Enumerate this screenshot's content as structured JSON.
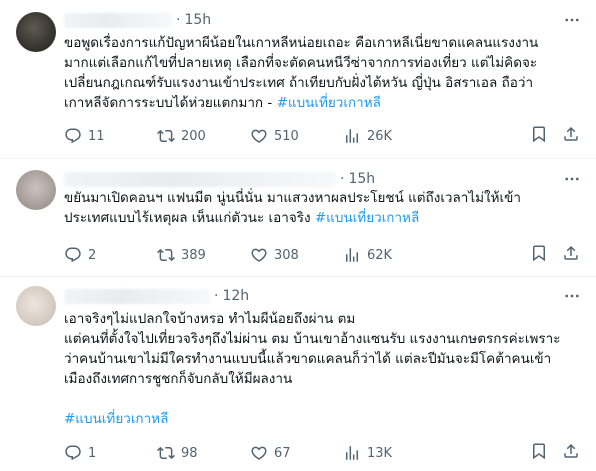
{
  "tweets": [
    {
      "time": "15h",
      "lines": [
        "ขอพูดเรื่องการแก้ปัญหาผีน้อยในเกาหลีหน่อยเถอะ คือเกาหลีเนี่ยขาดแคลนแรงงาน",
        "มากแต่เลือกแก้ไขที่ปลายเหตุ เลือกที่จะตัดคนหนีวีซ่าจากการท่องเที่ยว แต่ไม่คิดจะ",
        "เปลี่ยนกฎเกณฑ์รับแรงงานเข้าประเทศ ถ้าเทียบกับฝั่งไต้หวัน ญี่ปุ่น อิสราเอล ถือว่า"
      ],
      "last_line_text": "เกาหลีจัดการระบบได้ห่วยแตกมาก - ",
      "hashtag": "#แบนเที่ยวเกาหลี",
      "replies": "11",
      "reposts": "200",
      "likes": "510",
      "views": "26K"
    },
    {
      "time": "15h",
      "lines": [
        "ขยันมาเปิดคอนฯ แฟนมีต นู่นนี่นั่น มาแสวงหาผลประโยชน์ แต่ถึงเวลาไม่ให้เข้า"
      ],
      "last_line_text": "ประเทศแบบไร้เหตุผล เห็นแก่ตัวนะ เอาจริง ",
      "hashtag": "#แบนเที่ยวเกาหลี",
      "replies": "2",
      "reposts": "389",
      "likes": "308",
      "views": "62K"
    },
    {
      "time": "12h",
      "lines": [
        "เอาจริงๆไม่แปลกใจบ้างหรอ ทำไมผีน้อยถึงผ่าน ตม",
        "แต่คนที่ตั้งใจไปเที่ยวจริงๆถึงไม่ผ่าน ตม  บ้านเขาอ้างแซนรับ แรงงานเกษตรกรค่ะเพราะ",
        "ว่าคนบ้านเขาไม่มีใครทำงานแบบนี้แล้วขาดแคลนก็ว่าได้ แต่ละปีมันจะมีโคต้าคนเข้า",
        "เมืองถึงเทศการชูชกก็จับกลับให้มีผลงาน"
      ],
      "hashtag": "#แบนเที่ยวเกาหลี",
      "replies": "1",
      "reposts": "98",
      "likes": "67",
      "views": "13K"
    }
  ],
  "icons": {
    "more": "more-horizontal-icon",
    "reply": "speech-bubble-icon",
    "repost": "repost-arrows-icon",
    "like": "heart-icon",
    "views": "bar-chart-icon",
    "bookmark": "bookmark-icon",
    "share": "share-upload-icon"
  },
  "colors": {
    "hashtag": "#1d9bf0",
    "meta_text": "#536471",
    "body_text": "#0f1419",
    "divider": "#eff3f4"
  }
}
